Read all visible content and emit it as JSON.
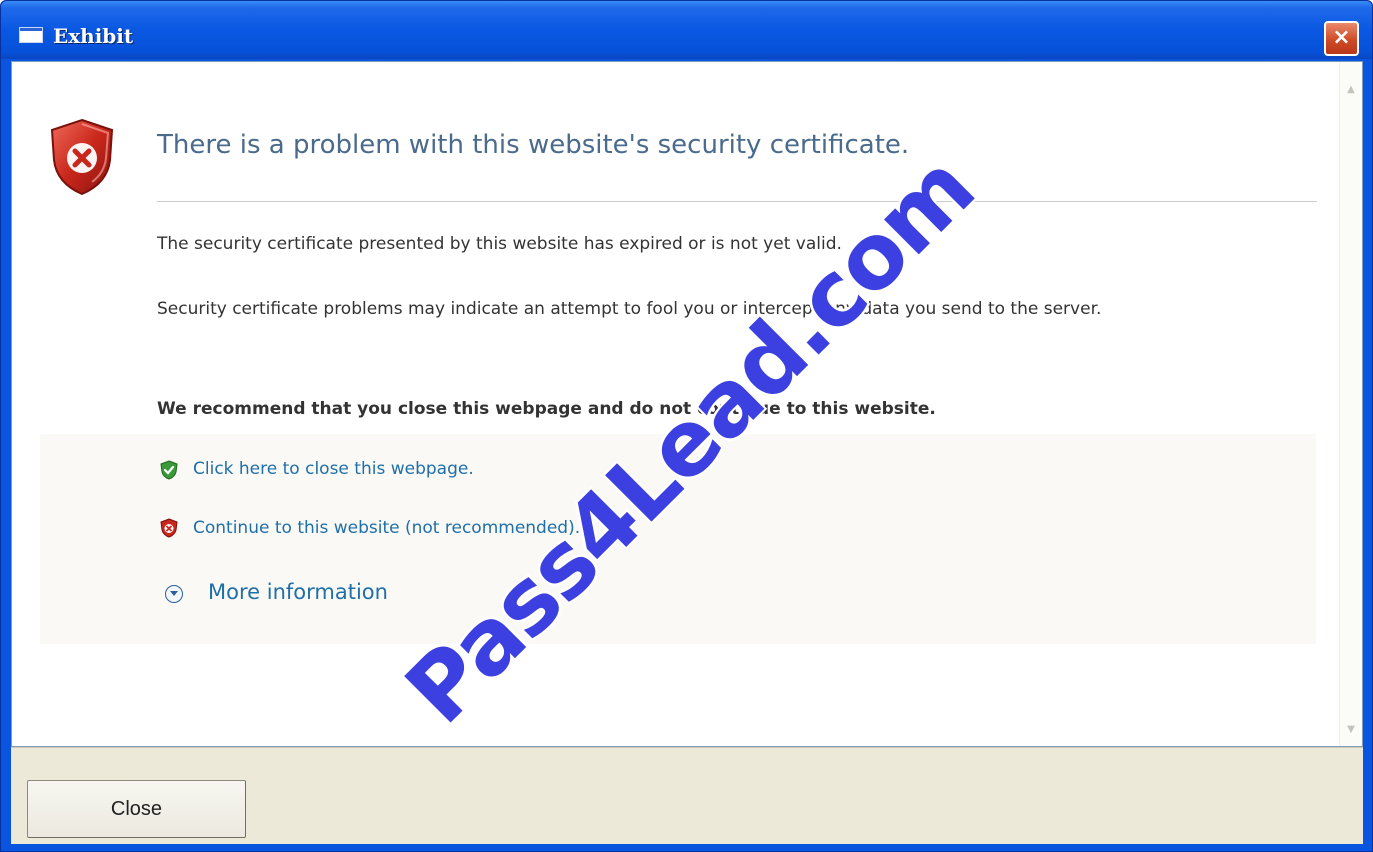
{
  "window": {
    "title": "Exhibit",
    "close_glyph": "×",
    "accent_color": "#0a55e0"
  },
  "content": {
    "headline": "There is a problem with this website's security certificate.",
    "paragraph1": "The security certificate presented by this website has expired or is not yet valid.",
    "paragraph2": "Security certificate problems may indicate an attempt to fool you or intercept any data you send to the server.",
    "recommendation": "We recommend that you close this webpage and do not continue to this website.",
    "links": {
      "close_webpage": "Click here to close this webpage.",
      "continue": "Continue to this website (not recommended).",
      "more_info": "More information"
    },
    "icons": {
      "main": "error-shield-icon",
      "close_webpage": "green-check-shield-icon",
      "continue": "red-x-shield-icon",
      "more_info": "chevron-down-circle-icon"
    }
  },
  "footer": {
    "close_label": "Close"
  },
  "watermark": "Pass4Lead.com"
}
